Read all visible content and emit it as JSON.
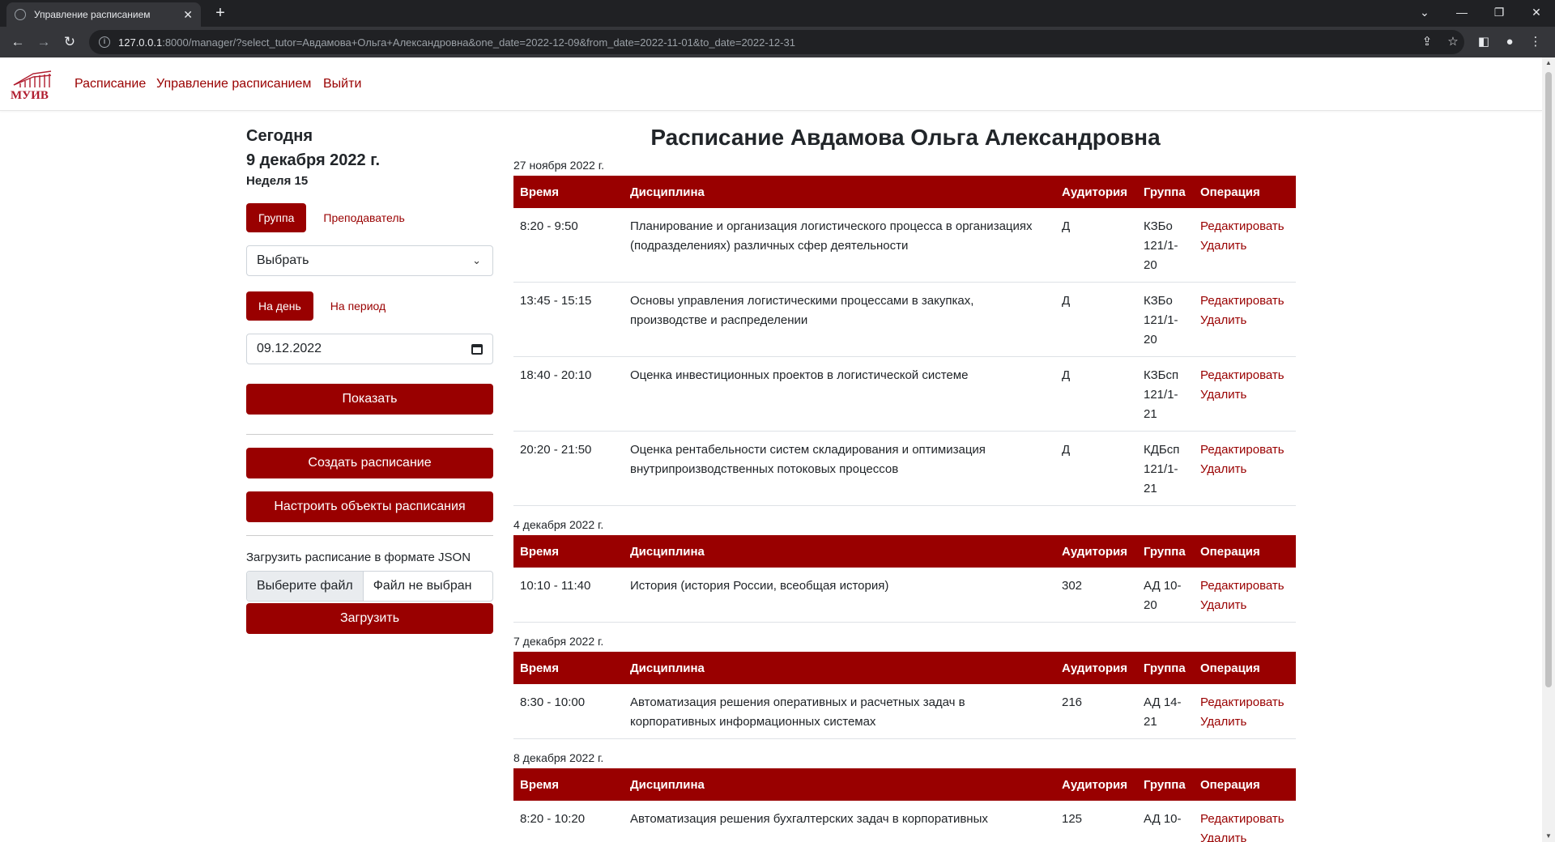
{
  "browser": {
    "tab_title": "Управление расписанием",
    "url_host": "127.0.0.1",
    "url_rest": ":8000/manager/?select_tutor=Авдамова+Ольга+Александровна&one_date=2022-12-09&from_date=2022-11-01&to_date=2022-12-31"
  },
  "navbar": {
    "logo_text": "МУИВ",
    "links": [
      "Расписание",
      "Управление расписанием",
      "Выйти"
    ]
  },
  "sidebar": {
    "today_label": "Сегодня",
    "today_date": "9 декабря 2022 г.",
    "week": "Неделя 15",
    "mode_group": "Группа",
    "mode_tutor": "Преподаватель",
    "select_value": "Выбрать",
    "range_day": "На день",
    "range_period": "На период",
    "date_value": "09.12.2022",
    "show_btn": "Показать",
    "create_btn": "Создать расписание",
    "config_btn": "Настроить объекты расписания",
    "json_label": "Загрузить расписание в формате JSON",
    "file_choose": "Выберите файл",
    "file_none": "Файл не выбран",
    "upload_btn": "Загрузить"
  },
  "main": {
    "title": "Расписание Авдамова Ольга Александровна",
    "headers": [
      "Время",
      "Дисциплина",
      "Аудитория",
      "Группа",
      "Операция"
    ],
    "edit_label": "Редактировать",
    "delete_label": "Удалить",
    "days": [
      {
        "date": "27 ноября 2022 г.",
        "rows": [
          {
            "time": "8:20 - 9:50",
            "discipline": "Планирование и организация логистического процесса в организациях (подразделениях) различных сфер деятельности",
            "room": "Д",
            "group": "КЗБо 121/1-20"
          },
          {
            "time": "13:45 - 15:15",
            "discipline": "Основы управления логистическими процессами в закупках, производстве и распределении",
            "room": "Д",
            "group": "КЗБо 121/1-20"
          },
          {
            "time": "18:40 - 20:10",
            "discipline": "Оценка инвестиционных проектов в логистической системе",
            "room": "Д",
            "group": "КЗБсп 121/1-21"
          },
          {
            "time": "20:20 - 21:50",
            "discipline": "Оценка рентабельности систем складирования и оптимизация внутрипроизводственных потоковых процессов",
            "room": "Д",
            "group": "КДБсп 121/1-21"
          }
        ]
      },
      {
        "date": "4 декабря 2022 г.",
        "rows": [
          {
            "time": "10:10 - 11:40",
            "discipline": "История (история России, всеобщая история)",
            "room": "302",
            "group": "АД 10-20"
          }
        ]
      },
      {
        "date": "7 декабря 2022 г.",
        "rows": [
          {
            "time": "8:30 - 10:00",
            "discipline": "Автоматизация решения оперативных и расчетных задач в корпоративных информационных системах",
            "room": "216",
            "group": "АД 14-21"
          }
        ]
      },
      {
        "date": "8 декабря 2022 г.",
        "rows": [
          {
            "time": "8:20 - 10:20",
            "discipline": "Автоматизация решения бухгалтерских задач в корпоративных",
            "room": "125",
            "group": "АД 10-"
          }
        ]
      }
    ]
  }
}
